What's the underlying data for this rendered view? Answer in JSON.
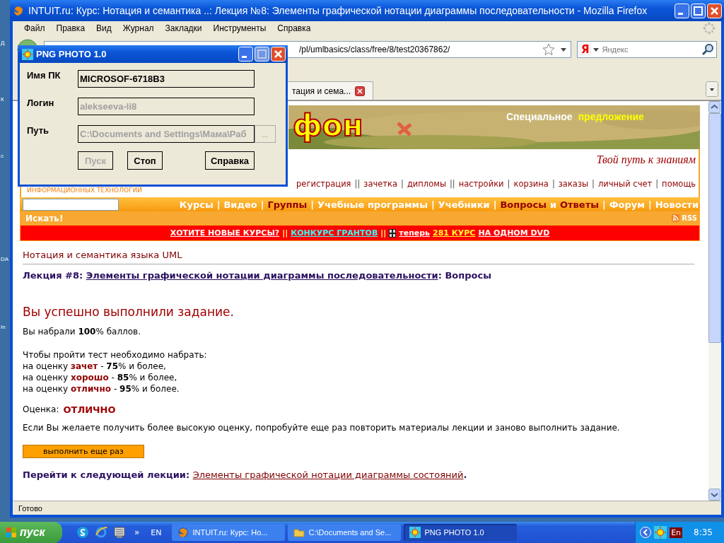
{
  "desktop": {
    "icon_labels": [
      "Д",
      "К",
      "с",
      "DA",
      "In"
    ]
  },
  "browser": {
    "title": "INTUIT.ru: Курс: Нотация и семантика ..: Лекция №8: Элементы графической нотации диаграммы последовательности - Mozilla Firefox",
    "menu": [
      "Файл",
      "Правка",
      "Вид",
      "Журнал",
      "Закладки",
      "Инструменты",
      "Справка"
    ],
    "address": "/pl/umlbasics/class/free/8/test20367862/",
    "search_engine_logo": "Я",
    "search_placeholder": "Яндекс",
    "tabs": [
      {
        "label": "тация и сема...",
        "selected": true
      }
    ],
    "status": "Готово"
  },
  "page": {
    "banner": {
      "logo_fragment": "фон",
      "offer": "Специальное",
      "offer_highlight": "предложение"
    },
    "tagline": "Твой путь к знаниям",
    "subtitle": "ИНФОРМАЦИОННЫХ ТЕХНОЛОГИЙ",
    "user_links": [
      {
        "kind": "link",
        "text": "регистрация"
      },
      {
        "kind": "sep",
        "text": "||"
      },
      {
        "kind": "link",
        "text": "зачетка"
      },
      {
        "kind": "sep",
        "text": "|"
      },
      {
        "kind": "link",
        "text": "дипломы"
      },
      {
        "kind": "sep",
        "text": "||"
      },
      {
        "kind": "link",
        "text": "настройки"
      },
      {
        "kind": "sep",
        "text": "|"
      },
      {
        "kind": "link",
        "text": "корзина"
      },
      {
        "kind": "sep",
        "text": "|"
      },
      {
        "kind": "link",
        "text": "заказы"
      },
      {
        "kind": "sep",
        "text": "|"
      },
      {
        "kind": "link",
        "text": "личный счет"
      },
      {
        "kind": "sep",
        "text": "|"
      },
      {
        "kind": "link",
        "text": "помощь"
      }
    ],
    "nav": [
      {
        "kind": "link",
        "text": "Курсы",
        "highlight": false
      },
      {
        "kind": "sep",
        "text": "|"
      },
      {
        "kind": "link",
        "text": "Видео",
        "highlight": false
      },
      {
        "kind": "sep",
        "text": "|"
      },
      {
        "kind": "link",
        "text": "Группы",
        "highlight": true
      },
      {
        "kind": "sep",
        "text": "|"
      },
      {
        "kind": "link",
        "text": "Учебные программы",
        "highlight": false
      },
      {
        "kind": "sep",
        "text": "|"
      },
      {
        "kind": "link",
        "text": "Учебники",
        "highlight": false
      },
      {
        "kind": "sep",
        "text": "|"
      },
      {
        "kind": "link",
        "text": "Вопросы",
        "highlight": true
      },
      {
        "kind": "word",
        "text": "и"
      },
      {
        "kind": "link",
        "text": "Ответы",
        "highlight": true
      },
      {
        "kind": "sep",
        "text": "|"
      },
      {
        "kind": "link",
        "text": "Форум",
        "highlight": false
      },
      {
        "kind": "sep",
        "text": "|"
      },
      {
        "kind": "link",
        "text": "Новости",
        "highlight": false
      }
    ],
    "search_button": "Искать!",
    "rss": "RSS",
    "promo": [
      {
        "kind": "link",
        "text": "ХОТИТЕ НОВЫЕ КУРСЫ?",
        "color": "#ffffff"
      },
      {
        "kind": "sep",
        "text": "||"
      },
      {
        "kind": "link",
        "text": "КОНКУРС ГРАНТОВ",
        "color": "#33ffff"
      },
      {
        "kind": "sep",
        "text": "||"
      },
      {
        "kind": "icon"
      },
      {
        "kind": "link",
        "text": "теперь",
        "color": "#ffffff"
      },
      {
        "kind": "link",
        "text": "281 КУРС",
        "color": "#ffff33"
      },
      {
        "kind": "link",
        "text": "НА ОДНОМ DVD",
        "color": "#ffffff"
      }
    ],
    "course_title": "Нотация и семантика языка UML",
    "lecture": {
      "prefix": "Лекция #8:",
      "link": "Элементы графической нотации диаграммы последовательности",
      "suffix": ": Вопросы"
    },
    "success": "Вы успешно выполнили задание.",
    "score": "Вы набрали **100**% баллов.",
    "requirements_intro": "Чтобы пройти тест необходимо набрать:",
    "requirements": [
      {
        "prefix": "на оценку",
        "grade": "зачет",
        "dash": "-",
        "percent": "75",
        "suffix": "% и более,"
      },
      {
        "prefix": "на оценку",
        "grade": "хорошо",
        "dash": "-",
        "percent": "85",
        "suffix": "% и более,"
      },
      {
        "prefix": "на оценку",
        "grade": "отлично",
        "dash": "-",
        "percent": "95",
        "suffix": "% и более."
      }
    ],
    "grade": {
      "label": "Оценка:",
      "value": "ОТЛИЧНО"
    },
    "advice": "Если Вы желаете получить более высокую оценку, попробуйте еще раз повторить материалы лекции и заново выполнить задание.",
    "retry_button": "выполнить еще раз",
    "next": {
      "prefix": "Перейти к следующей лекции:",
      "link": "Элементы графической нотации диаграммы состояний",
      "suffix": "."
    }
  },
  "dialog": {
    "title": "PNG PHOTO 1.0",
    "fields": [
      {
        "label": "Имя ПК",
        "value": "MICROSOF-6718B3",
        "disabled": false
      },
      {
        "label": "Логин",
        "value": "alekseeva-li8",
        "disabled": true
      },
      {
        "label": "Путь",
        "value": "C:\\Documents and Settings\\Мама\\Раб",
        "disabled": true,
        "browse": "..."
      }
    ],
    "buttons": [
      {
        "label": "Пуск",
        "disabled": true
      },
      {
        "label": "Стоп",
        "disabled": false
      },
      {
        "label": "Справка",
        "disabled": false
      }
    ]
  },
  "taskbar": {
    "start": "пуск",
    "more": "»",
    "language": "EN",
    "tasks": [
      {
        "label": "INTUIT.ru: Курс: Но...",
        "kind": "browser",
        "selected": false
      },
      {
        "label": "C:\\Documents and Se...",
        "kind": "folder",
        "selected": false
      },
      {
        "label": "PNG PHOTO 1.0",
        "kind": "sun",
        "selected": true
      }
    ],
    "tray_language": "En",
    "clock": "8:35"
  }
}
